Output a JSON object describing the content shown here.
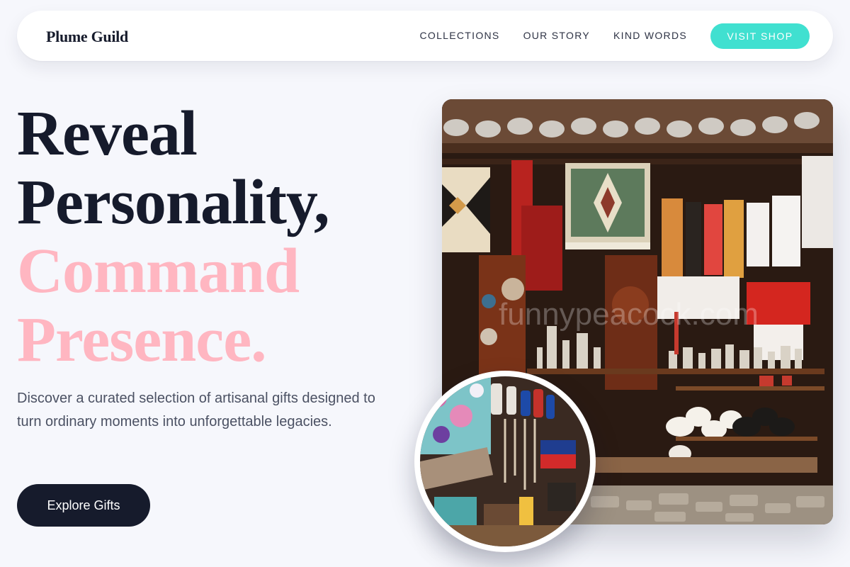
{
  "brand": {
    "name": "Plume Guild"
  },
  "nav": {
    "links": [
      {
        "label": "COLLECTIONS"
      },
      {
        "label": "OUR STORY"
      },
      {
        "label": "KIND WORDS"
      }
    ],
    "cta_label": "VISIT SHOP"
  },
  "hero": {
    "headline_dark": [
      "Reveal",
      "Personality,"
    ],
    "headline_accent": [
      "Command",
      "Presence."
    ],
    "description": "Discover a curated selection of artisanal gifts designed to turn ordinary moments into unforgettable legacies.",
    "cta_label": "Explore Gifts",
    "image_watermark": "funnypeacock.com"
  },
  "colors": {
    "background": "#f6f7fc",
    "ink": "#161b2c",
    "accent_pink": "#ffb6c1",
    "accent_turquoise": "#40e0d0"
  }
}
